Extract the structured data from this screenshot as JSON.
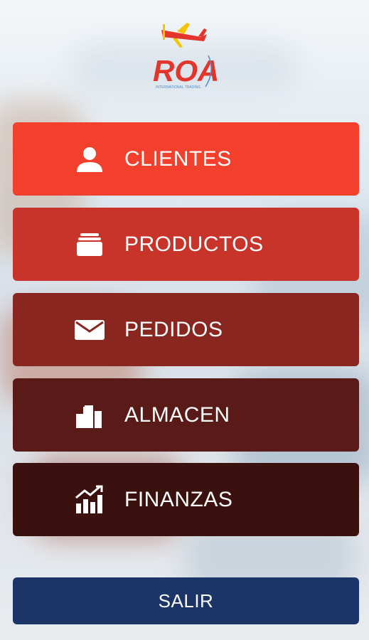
{
  "logo": {
    "text": "ROA",
    "tagline": "INTERNATIONAL TRADING"
  },
  "menu": [
    {
      "label": "CLIENTES",
      "icon": "user-icon",
      "color": "#f2402d"
    },
    {
      "label": "PRODUCTOS",
      "icon": "box-icon",
      "color": "#c8342a"
    },
    {
      "label": "PEDIDOS",
      "icon": "envelope-icon",
      "color": "#8a2620"
    },
    {
      "label": "ALMACEN",
      "icon": "warehouse-icon",
      "color": "#5a1a17"
    },
    {
      "label": "FINANZAS",
      "icon": "chart-icon",
      "color": "#3a110e"
    }
  ],
  "exit": {
    "label": "SALIR",
    "color": "#1b3568"
  }
}
